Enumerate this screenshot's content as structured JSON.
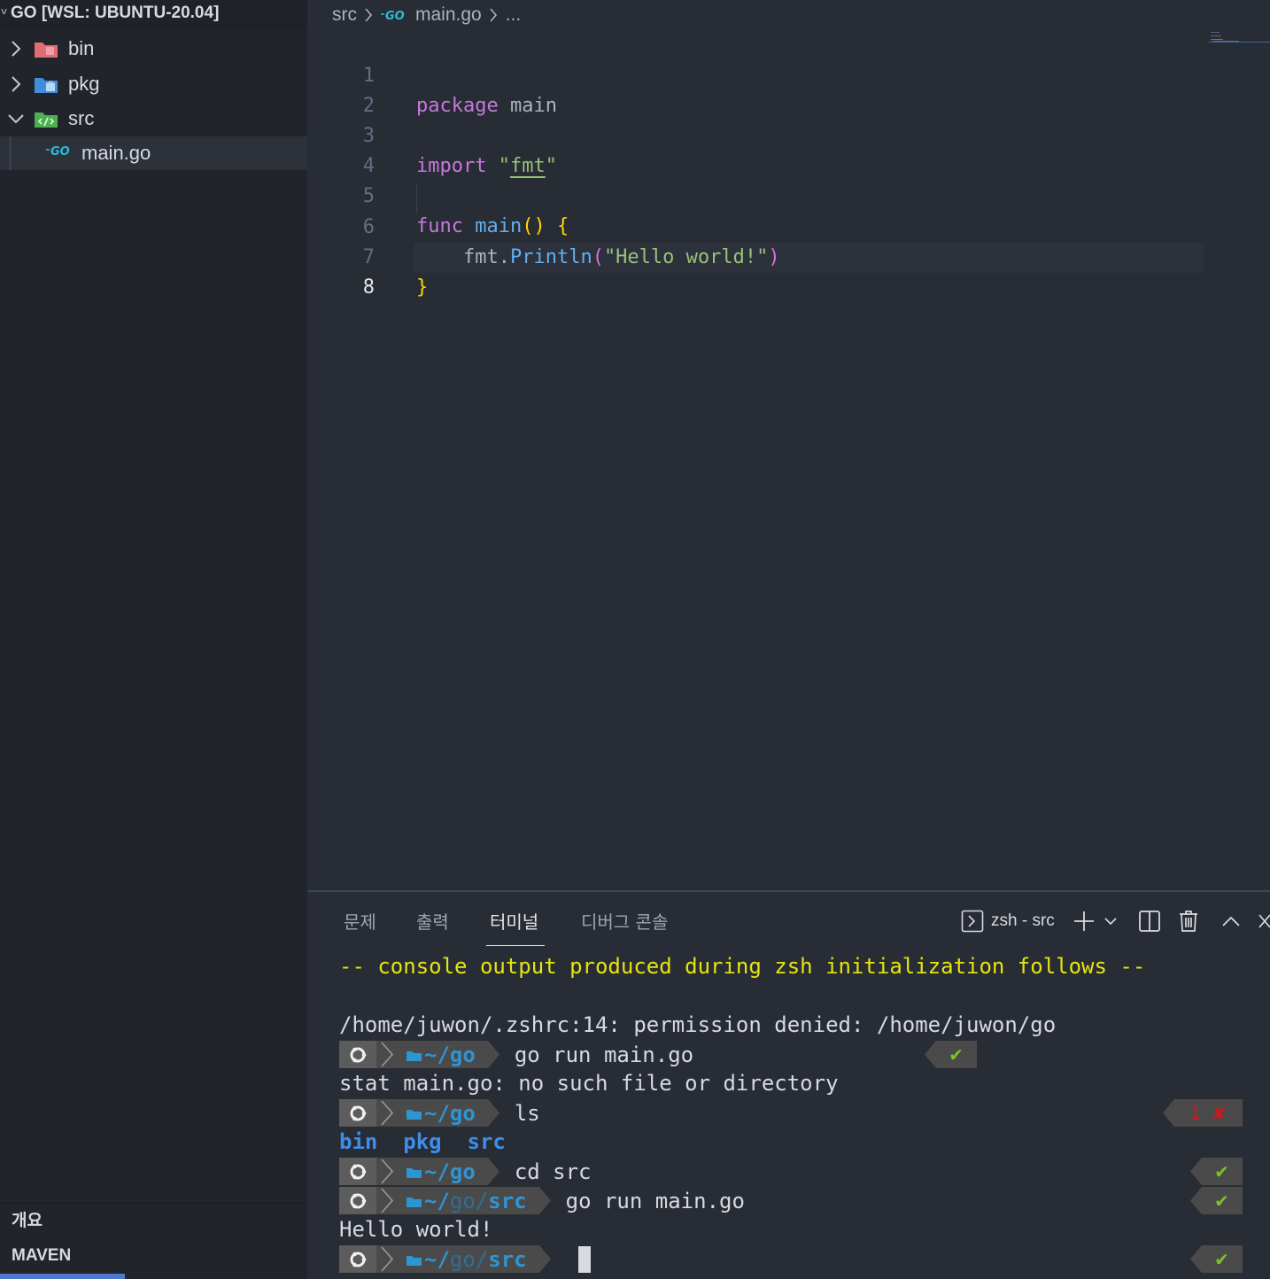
{
  "sidebar": {
    "workspace_title": "GO [WSL: UBUNTU-20.04]",
    "items": [
      {
        "label": "bin",
        "icon": "folder-bin-icon",
        "expanded": false
      },
      {
        "label": "pkg",
        "icon": "folder-pkg-icon",
        "expanded": false
      },
      {
        "label": "src",
        "icon": "folder-src-icon",
        "expanded": true
      },
      {
        "label": "main.go",
        "icon": "go-file-icon",
        "selected": true
      }
    ],
    "sections": {
      "outline": "개요",
      "maven": "MAVEN"
    },
    "colors": {
      "bin_folder": "#e06c75",
      "pkg_folder": "#3e8edc",
      "src_folder": "#4caf50",
      "go_icon": "#29bcd7"
    }
  },
  "editor": {
    "breadcrumb": {
      "folder": "src",
      "file": "main.go",
      "more": "..."
    },
    "lines": [
      {
        "n": "1",
        "kw": "package",
        "rest": " main"
      },
      {
        "n": "2"
      },
      {
        "n": "3",
        "kw": "import",
        "q1": " \"",
        "str": "fmt",
        "q2": "\""
      },
      {
        "n": "4"
      },
      {
        "n": "5",
        "kw": "func",
        "sp": " ",
        "fn": "main",
        "paren": "()",
        "sp2": " ",
        "brace": "{"
      },
      {
        "n": "6",
        "ind": "    ",
        "obj": "fmt.",
        "fn": "Println",
        "open": "(",
        "str": "\"Hello world!\"",
        "close": ")"
      },
      {
        "n": "7",
        "brace": "}"
      },
      {
        "n": "8"
      }
    ],
    "current_line": 8
  },
  "panel": {
    "tabs": [
      "문제",
      "출력",
      "터미널",
      "디버그 콘솔"
    ],
    "active_tab": "터미널",
    "shell": "zsh - src"
  },
  "terminal": {
    "banner": "-- console output produced during zsh initialization follows --",
    "permission_line": "/home/juwon/.zshrc:14: permission denied: /home/juwon/go",
    "prompts": [
      {
        "home": "~/",
        "path_dim": "",
        "path": "go",
        "cmd": "go run main.go",
        "status": "✔",
        "status_type": "ok"
      },
      {
        "home": "~/",
        "path_dim": "",
        "path": "go",
        "cmd": "ls",
        "status_code": "1",
        "status": "✘",
        "status_type": "error"
      },
      {
        "home": "~/",
        "path_dim": "",
        "path": "go",
        "cmd": "cd src",
        "status": "✔",
        "status_type": "ok"
      },
      {
        "home": "~/",
        "path_dim": "go/",
        "path": "src",
        "cmd": "go run main.go",
        "status": "✔",
        "status_type": "ok"
      },
      {
        "home": "~/",
        "path_dim": "go/",
        "path": "src",
        "cmd": "",
        "status": "✔",
        "status_type": "ok"
      }
    ],
    "stat_error": "stat main.go: no such file or directory",
    "ls_output": [
      "bin",
      "pkg",
      "src"
    ],
    "hello_output": "Hello world!"
  }
}
